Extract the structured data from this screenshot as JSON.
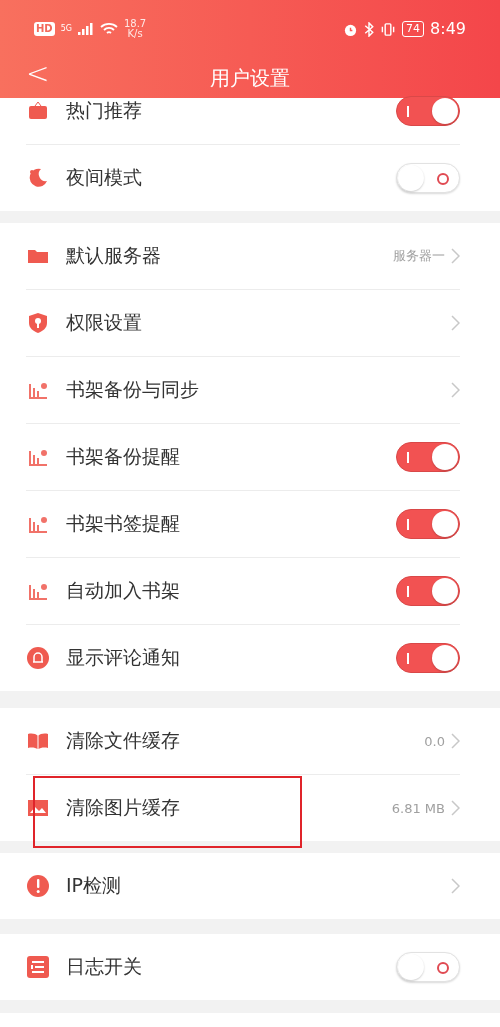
{
  "status_bar": {
    "hd": "HD",
    "network": "5G",
    "speed": "18.7",
    "speed_unit": "K/s",
    "battery": "74",
    "time": "8:49"
  },
  "header": {
    "back": "<",
    "title": "用户设置"
  },
  "sections": [
    {
      "items": [
        {
          "label": "热门推荐",
          "kind": "toggle",
          "on": true
        },
        {
          "label": "夜间模式",
          "kind": "toggle",
          "on": false
        }
      ]
    },
    {
      "items": [
        {
          "label": "默认服务器",
          "kind": "link",
          "value": "服务器一"
        },
        {
          "label": "权限设置",
          "kind": "link"
        },
        {
          "label": "书架备份与同步",
          "kind": "link"
        },
        {
          "label": "书架备份提醒",
          "kind": "toggle",
          "on": true
        },
        {
          "label": "书架书签提醒",
          "kind": "toggle",
          "on": true
        },
        {
          "label": "自动加入书架",
          "kind": "toggle",
          "on": true
        },
        {
          "label": "显示评论通知",
          "kind": "toggle",
          "on": true
        }
      ]
    },
    {
      "items": [
        {
          "label": "清除文件缓存",
          "kind": "link",
          "value": "0.0"
        },
        {
          "label": "清除图片缓存",
          "kind": "link",
          "value": "6.81 MB",
          "highlight": true
        }
      ]
    },
    {
      "items": [
        {
          "label": "IP检测",
          "kind": "link"
        }
      ]
    },
    {
      "items": [
        {
          "label": "日志开关",
          "kind": "toggle",
          "on": false
        }
      ]
    }
  ]
}
